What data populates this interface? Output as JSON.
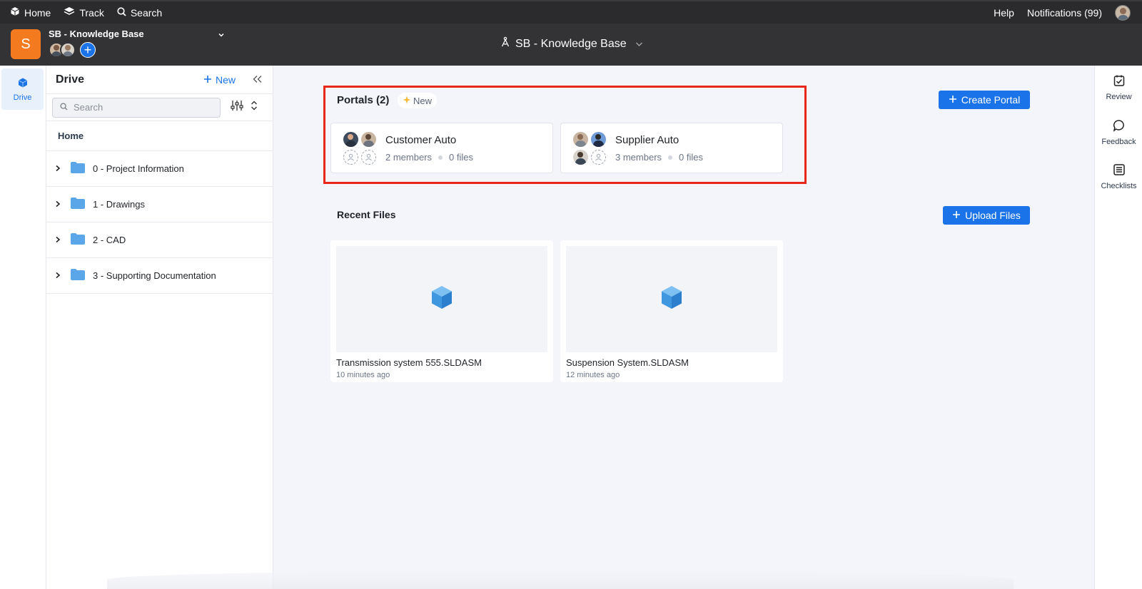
{
  "topnav": {
    "home_label": "Home",
    "track_label": "Track",
    "search_label": "Search",
    "help_label": "Help",
    "notifications_label": "Notifications (99)"
  },
  "project": {
    "badge_letter": "S",
    "name": "SB - Knowledge Base",
    "center_title": "SB - Knowledge Base"
  },
  "rail": {
    "drive_label": "Drive"
  },
  "drive": {
    "title": "Drive",
    "new_label": "New",
    "search_placeholder": "Search",
    "home_label": "Home",
    "folders": [
      {
        "label": "0 - Project Information"
      },
      {
        "label": "1 - Drawings"
      },
      {
        "label": "2 - CAD"
      },
      {
        "label": "3 - Supporting Documentation"
      }
    ]
  },
  "right_rail": {
    "items": [
      {
        "label": "Review"
      },
      {
        "label": "Feedback"
      },
      {
        "label": "Checklists"
      }
    ]
  },
  "portals": {
    "title": "Portals (2)",
    "new_badge": "New",
    "create_label": "Create Portal",
    "cards": [
      {
        "name": "Customer Auto",
        "members": "2 members",
        "files": "0 files"
      },
      {
        "name": "Supplier Auto",
        "members": "3 members",
        "files": "0 files"
      }
    ]
  },
  "recent": {
    "title": "Recent Files",
    "upload_label": "Upload Files",
    "files": [
      {
        "name": "Transmission system 555.SLDASM",
        "time": "10 minutes ago"
      },
      {
        "name": "Suspension System.SLDASM",
        "time": "12 minutes ago"
      }
    ]
  },
  "colors": {
    "accent": "#1a73e8",
    "highlight_border": "#e8261a",
    "project_badge": "#f47a1f"
  }
}
